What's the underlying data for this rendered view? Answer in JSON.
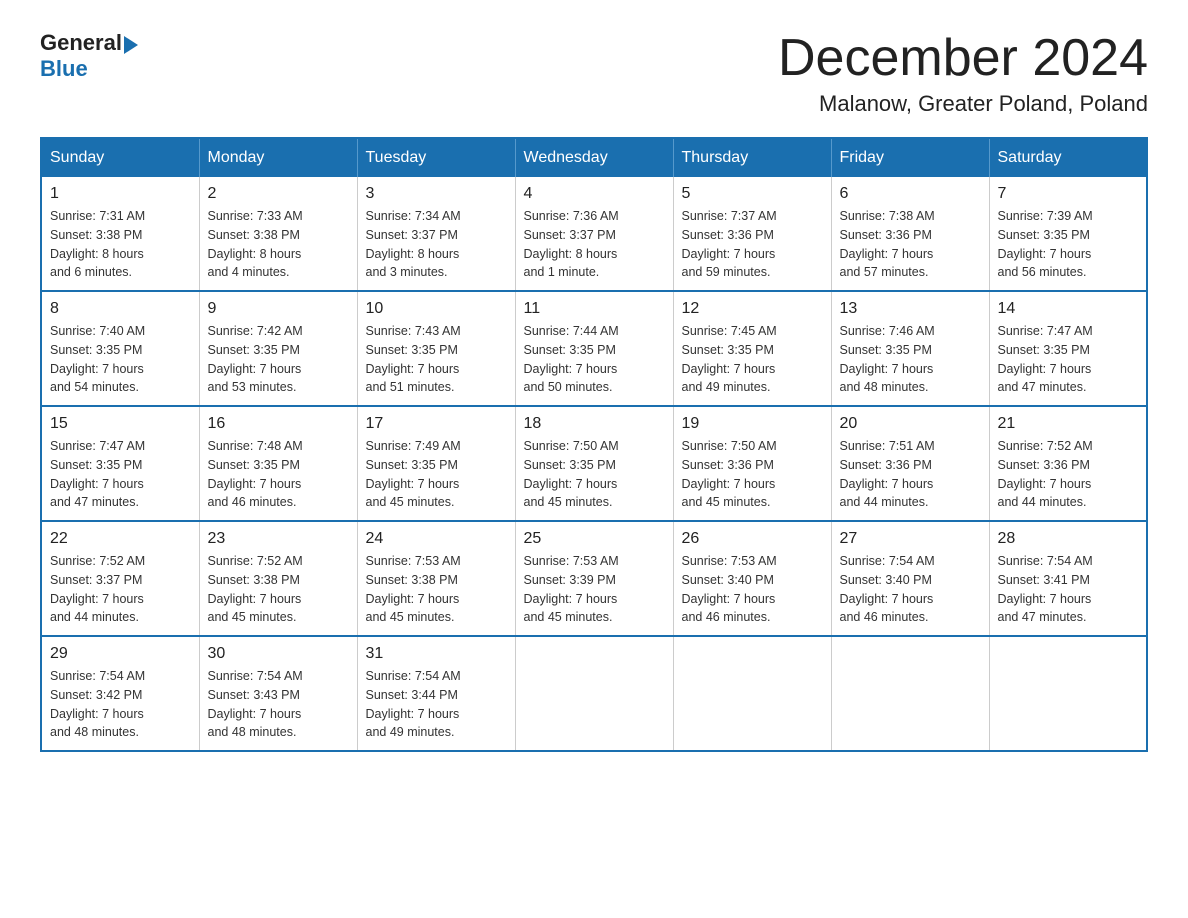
{
  "logo": {
    "general": "General",
    "blue": "Blue"
  },
  "title": "December 2024",
  "location": "Malanow, Greater Poland, Poland",
  "headers": [
    "Sunday",
    "Monday",
    "Tuesday",
    "Wednesday",
    "Thursday",
    "Friday",
    "Saturday"
  ],
  "weeks": [
    [
      {
        "day": "1",
        "sunrise": "7:31 AM",
        "sunset": "3:38 PM",
        "daylight": "8 hours and 6 minutes."
      },
      {
        "day": "2",
        "sunrise": "7:33 AM",
        "sunset": "3:38 PM",
        "daylight": "8 hours and 4 minutes."
      },
      {
        "day": "3",
        "sunrise": "7:34 AM",
        "sunset": "3:37 PM",
        "daylight": "8 hours and 3 minutes."
      },
      {
        "day": "4",
        "sunrise": "7:36 AM",
        "sunset": "3:37 PM",
        "daylight": "8 hours and 1 minute."
      },
      {
        "day": "5",
        "sunrise": "7:37 AM",
        "sunset": "3:36 PM",
        "daylight": "7 hours and 59 minutes."
      },
      {
        "day": "6",
        "sunrise": "7:38 AM",
        "sunset": "3:36 PM",
        "daylight": "7 hours and 57 minutes."
      },
      {
        "day": "7",
        "sunrise": "7:39 AM",
        "sunset": "3:35 PM",
        "daylight": "7 hours and 56 minutes."
      }
    ],
    [
      {
        "day": "8",
        "sunrise": "7:40 AM",
        "sunset": "3:35 PM",
        "daylight": "7 hours and 54 minutes."
      },
      {
        "day": "9",
        "sunrise": "7:42 AM",
        "sunset": "3:35 PM",
        "daylight": "7 hours and 53 minutes."
      },
      {
        "day": "10",
        "sunrise": "7:43 AM",
        "sunset": "3:35 PM",
        "daylight": "7 hours and 51 minutes."
      },
      {
        "day": "11",
        "sunrise": "7:44 AM",
        "sunset": "3:35 PM",
        "daylight": "7 hours and 50 minutes."
      },
      {
        "day": "12",
        "sunrise": "7:45 AM",
        "sunset": "3:35 PM",
        "daylight": "7 hours and 49 minutes."
      },
      {
        "day": "13",
        "sunrise": "7:46 AM",
        "sunset": "3:35 PM",
        "daylight": "7 hours and 48 minutes."
      },
      {
        "day": "14",
        "sunrise": "7:47 AM",
        "sunset": "3:35 PM",
        "daylight": "7 hours and 47 minutes."
      }
    ],
    [
      {
        "day": "15",
        "sunrise": "7:47 AM",
        "sunset": "3:35 PM",
        "daylight": "7 hours and 47 minutes."
      },
      {
        "day": "16",
        "sunrise": "7:48 AM",
        "sunset": "3:35 PM",
        "daylight": "7 hours and 46 minutes."
      },
      {
        "day": "17",
        "sunrise": "7:49 AM",
        "sunset": "3:35 PM",
        "daylight": "7 hours and 45 minutes."
      },
      {
        "day": "18",
        "sunrise": "7:50 AM",
        "sunset": "3:35 PM",
        "daylight": "7 hours and 45 minutes."
      },
      {
        "day": "19",
        "sunrise": "7:50 AM",
        "sunset": "3:36 PM",
        "daylight": "7 hours and 45 minutes."
      },
      {
        "day": "20",
        "sunrise": "7:51 AM",
        "sunset": "3:36 PM",
        "daylight": "7 hours and 44 minutes."
      },
      {
        "day": "21",
        "sunrise": "7:52 AM",
        "sunset": "3:36 PM",
        "daylight": "7 hours and 44 minutes."
      }
    ],
    [
      {
        "day": "22",
        "sunrise": "7:52 AM",
        "sunset": "3:37 PM",
        "daylight": "7 hours and 44 minutes."
      },
      {
        "day": "23",
        "sunrise": "7:52 AM",
        "sunset": "3:38 PM",
        "daylight": "7 hours and 45 minutes."
      },
      {
        "day": "24",
        "sunrise": "7:53 AM",
        "sunset": "3:38 PM",
        "daylight": "7 hours and 45 minutes."
      },
      {
        "day": "25",
        "sunrise": "7:53 AM",
        "sunset": "3:39 PM",
        "daylight": "7 hours and 45 minutes."
      },
      {
        "day": "26",
        "sunrise": "7:53 AM",
        "sunset": "3:40 PM",
        "daylight": "7 hours and 46 minutes."
      },
      {
        "day": "27",
        "sunrise": "7:54 AM",
        "sunset": "3:40 PM",
        "daylight": "7 hours and 46 minutes."
      },
      {
        "day": "28",
        "sunrise": "7:54 AM",
        "sunset": "3:41 PM",
        "daylight": "7 hours and 47 minutes."
      }
    ],
    [
      {
        "day": "29",
        "sunrise": "7:54 AM",
        "sunset": "3:42 PM",
        "daylight": "7 hours and 48 minutes."
      },
      {
        "day": "30",
        "sunrise": "7:54 AM",
        "sunset": "3:43 PM",
        "daylight": "7 hours and 48 minutes."
      },
      {
        "day": "31",
        "sunrise": "7:54 AM",
        "sunset": "3:44 PM",
        "daylight": "7 hours and 49 minutes."
      },
      null,
      null,
      null,
      null
    ]
  ],
  "labels": {
    "sunrise": "Sunrise:",
    "sunset": "Sunset:",
    "daylight": "Daylight:"
  }
}
